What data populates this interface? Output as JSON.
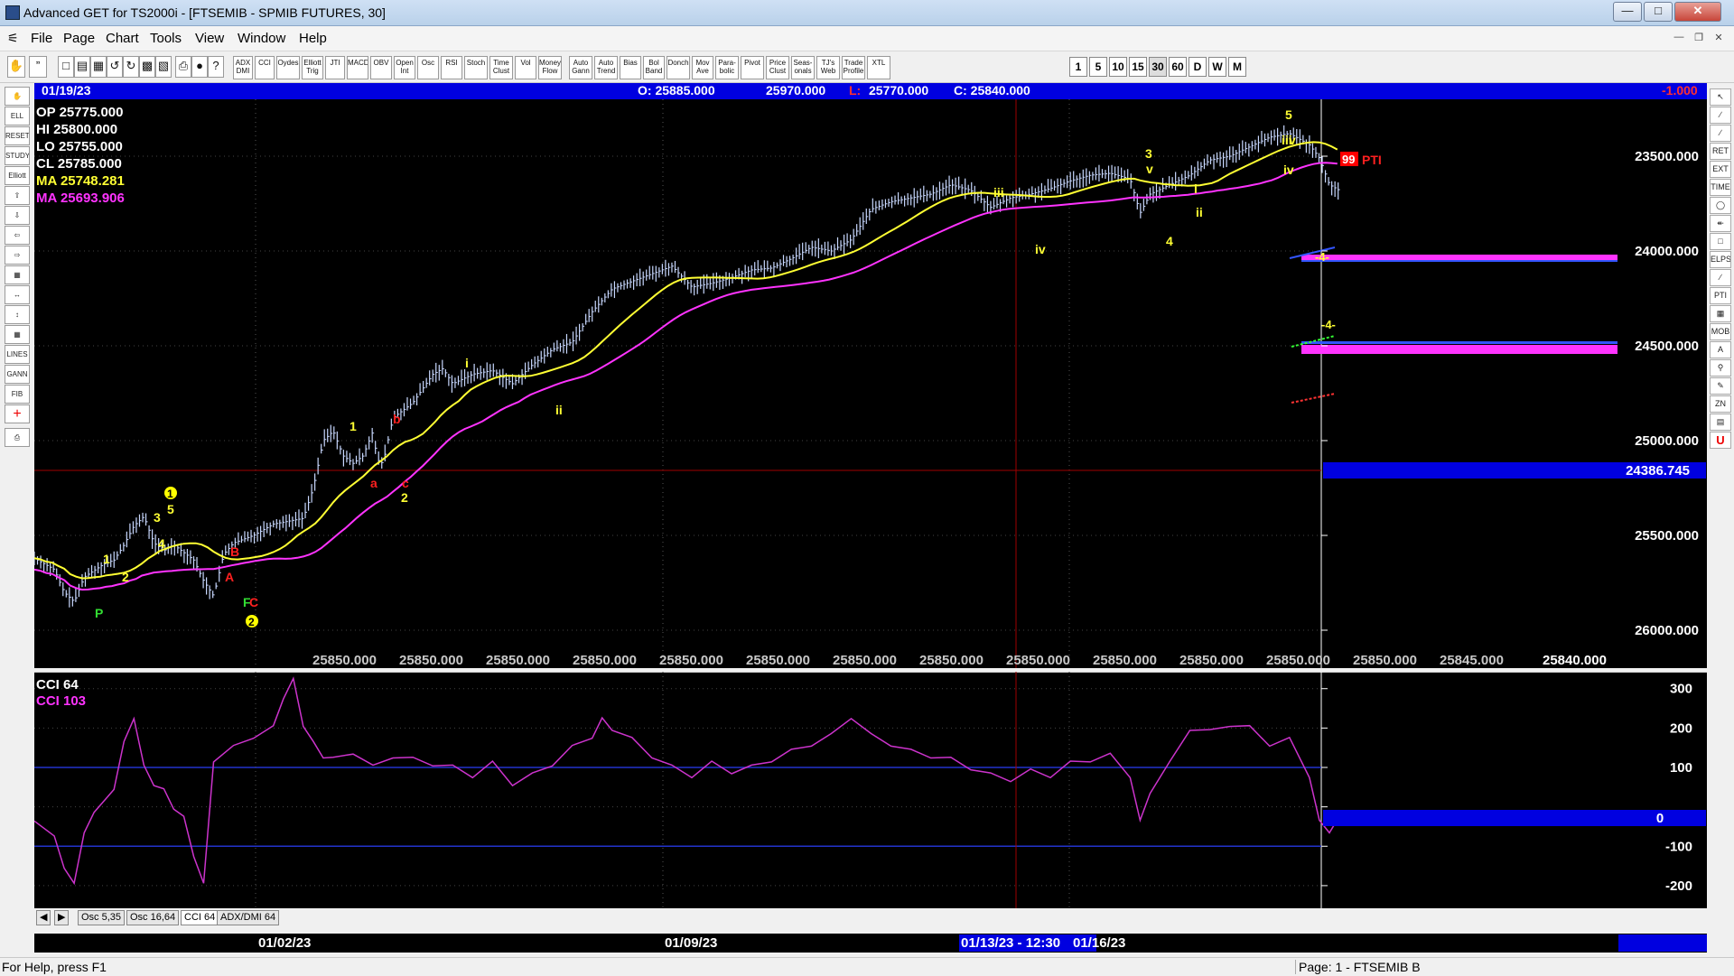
{
  "window": {
    "title": "Advanced GET for TS2000i - [FTSEMIB - SPMIB FUTURES, 30]"
  },
  "menu": {
    "items": [
      "File",
      "Page",
      "Chart",
      "Tools",
      "View",
      "Window",
      "Help"
    ]
  },
  "toolbar": {
    "study_buttons": [
      "ADX DMI",
      "CCI",
      "Oydes",
      "Elliott Trig",
      "JTI",
      "MACD",
      "OBV",
      "Open Int",
      "Osc",
      "RSI",
      "Stoch",
      "Time Clust",
      "Vol",
      "Money Flow",
      "Auto Gann",
      "Auto Trend",
      "Bias",
      "Bol Band",
      "Donch",
      "Mov Ave",
      "Para-bolic",
      "Pivot",
      "Price Clust",
      "Seas-onals",
      "TJ's Web",
      "Trade Profile",
      "XTL"
    ],
    "timeframes": [
      "1",
      "5",
      "10",
      "15",
      "30",
      "60",
      "D",
      "W",
      "M"
    ],
    "active_timeframe": "30"
  },
  "left_tools": [
    "hand",
    "paste",
    "ELLIOTT",
    "RESET",
    "STUDY",
    "Elliott",
    "up",
    "down",
    "left",
    "right",
    "zoom",
    "expand",
    "mid",
    "LINES",
    "GANN",
    "FIB",
    "cross",
    "print"
  ],
  "right_tools": [
    "cursor",
    "line",
    "pitch",
    "FIB RET",
    "FIB EXT",
    "FIB TIME",
    "ring",
    "fan",
    "box",
    "ELPS",
    "channel",
    "PTI",
    "grid",
    "MOB",
    "text",
    "zoom",
    "draw",
    "ZONES",
    "page",
    "U"
  ],
  "info_bar": {
    "date": "01/19/23",
    "open": "O: 25885.000",
    "high": "25970.000",
    "low_label": "L:",
    "low": "25770.000",
    "close": "C: 25840.000",
    "change": "-1.000"
  },
  "ohlc_panel": {
    "op": "OP  25775.000",
    "hi": "HI   25800.000",
    "lo": "LO  25755.000",
    "cl": "CL  25785.000",
    "ma1": "MA  25748.281",
    "ma2": "MA  25693.906"
  },
  "price_axis": {
    "labels": [
      "26000.000",
      "25500.000",
      "25000.000",
      "24500.000",
      "24000.000",
      "23500.000"
    ],
    "cursor_price": "24386.745"
  },
  "bottom_price_labels": [
    "25850.000",
    "25850.000",
    "25850.000",
    "25850.000",
    "25850.000",
    "25850.000",
    "25850.000",
    "25850.000",
    "25850.000",
    "25850.000",
    "25850.000",
    "25850.000",
    "25850.000",
    "25845.000",
    "25840.000"
  ],
  "pti": {
    "value": "99",
    "label": "PTI"
  },
  "projection_labels": [
    "-4-",
    "-4-"
  ],
  "wave_labels": [
    "P",
    "1",
    "2",
    "3",
    "4",
    "5",
    "1",
    "2",
    "B",
    "A",
    "C",
    "F",
    "2",
    "1",
    "a",
    "b",
    "c",
    "2",
    "i",
    "ii",
    "iii",
    "iv",
    "3",
    "v",
    "4",
    "i",
    "ii",
    "5",
    "iii",
    "v",
    "iv"
  ],
  "chart_data": {
    "type": "line",
    "price_axis": {
      "min": 23300,
      "max": 26300,
      "ticks": [
        23500,
        24000,
        24500,
        25000,
        25500,
        26000
      ]
    },
    "series": [
      {
        "name": "MA",
        "role": "fast-ma",
        "color": "#ffff33"
      },
      {
        "name": "MA",
        "role": "slow-ma",
        "color": "#ff33ff"
      }
    ],
    "close_path": [
      [
        0,
        23880
      ],
      [
        10,
        23820
      ],
      [
        15,
        23700
      ],
      [
        20,
        23650
      ],
      [
        25,
        23780
      ],
      [
        35,
        23850
      ],
      [
        40,
        23870
      ],
      [
        45,
        23950
      ],
      [
        50,
        24050
      ],
      [
        55,
        24100
      ],
      [
        60,
        23960
      ],
      [
        65,
        23920
      ],
      [
        70,
        23950
      ],
      [
        80,
        23870
      ],
      [
        85,
        23760
      ],
      [
        90,
        23680
      ],
      [
        95,
        23900
      ],
      [
        100,
        23960
      ],
      [
        110,
        24000
      ],
      [
        120,
        24060
      ],
      [
        135,
        24090
      ],
      [
        140,
        24250
      ],
      [
        145,
        24500
      ],
      [
        150,
        24550
      ],
      [
        155,
        24420
      ],
      [
        160,
        24380
      ],
      [
        165,
        24420
      ],
      [
        170,
        24550
      ],
      [
        172,
        24400
      ],
      [
        175,
        24380
      ],
      [
        180,
        24620
      ],
      [
        190,
        24700
      ],
      [
        200,
        24850
      ],
      [
        205,
        24880
      ],
      [
        210,
        24800
      ],
      [
        220,
        24850
      ],
      [
        230,
        24870
      ],
      [
        240,
        24800
      ],
      [
        250,
        24900
      ],
      [
        260,
        24980
      ],
      [
        270,
        25020
      ],
      [
        280,
        25180
      ],
      [
        290,
        25300
      ],
      [
        300,
        25340
      ],
      [
        310,
        25380
      ],
      [
        320,
        25420
      ],
      [
        330,
        25310
      ],
      [
        340,
        25330
      ],
      [
        350,
        25360
      ],
      [
        360,
        25400
      ],
      [
        370,
        25410
      ],
      [
        380,
        25460
      ],
      [
        390,
        25520
      ],
      [
        400,
        25500
      ],
      [
        410,
        25560
      ],
      [
        420,
        25720
      ],
      [
        430,
        25760
      ],
      [
        440,
        25780
      ],
      [
        450,
        25800
      ],
      [
        460,
        25850
      ],
      [
        470,
        25820
      ],
      [
        480,
        25730
      ],
      [
        490,
        25780
      ],
      [
        500,
        25800
      ],
      [
        510,
        25830
      ],
      [
        520,
        25870
      ],
      [
        530,
        25900
      ],
      [
        540,
        25910
      ],
      [
        550,
        25880
      ],
      [
        555,
        25700
      ],
      [
        560,
        25800
      ],
      [
        570,
        25850
      ],
      [
        580,
        25900
      ],
      [
        590,
        25980
      ],
      [
        600,
        26000
      ],
      [
        610,
        26050
      ],
      [
        620,
        26100
      ],
      [
        630,
        26120
      ],
      [
        640,
        26060
      ],
      [
        645,
        25990
      ],
      [
        650,
        25850
      ],
      [
        655,
        25820
      ]
    ],
    "cci": {
      "name": "CCI 64",
      "value_label": "CCI  103",
      "axis": {
        "min": -230,
        "max": 320,
        "ticks": [
          300,
          200,
          100,
          0,
          -100,
          -200
        ]
      },
      "current": "0",
      "path": [
        [
          0,
          -30
        ],
        [
          10,
          -80
        ],
        [
          15,
          -150
        ],
        [
          20,
          -200
        ],
        [
          25,
          -60
        ],
        [
          30,
          -20
        ],
        [
          40,
          50
        ],
        [
          45,
          160
        ],
        [
          50,
          230
        ],
        [
          55,
          100
        ],
        [
          60,
          60
        ],
        [
          65,
          40
        ],
        [
          70,
          0
        ],
        [
          75,
          -30
        ],
        [
          80,
          -120
        ],
        [
          85,
          -200
        ],
        [
          90,
          120
        ],
        [
          100,
          150
        ],
        [
          110,
          180
        ],
        [
          120,
          200
        ],
        [
          125,
          280
        ],
        [
          130,
          320
        ],
        [
          135,
          210
        ],
        [
          140,
          160
        ],
        [
          145,
          130
        ],
        [
          150,
          120
        ],
        [
          160,
          140
        ],
        [
          170,
          100
        ],
        [
          180,
          130
        ],
        [
          190,
          120
        ],
        [
          200,
          110
        ],
        [
          210,
          100
        ],
        [
          220,
          80
        ],
        [
          230,
          110
        ],
        [
          240,
          60
        ],
        [
          250,
          80
        ],
        [
          260,
          110
        ],
        [
          270,
          150
        ],
        [
          280,
          180
        ],
        [
          285,
          220
        ],
        [
          290,
          200
        ],
        [
          300,
          170
        ],
        [
          310,
          130
        ],
        [
          320,
          100
        ],
        [
          330,
          80
        ],
        [
          340,
          110
        ],
        [
          350,
          90
        ],
        [
          360,
          100
        ],
        [
          370,
          120
        ],
        [
          380,
          140
        ],
        [
          390,
          160
        ],
        [
          400,
          180
        ],
        [
          410,
          230
        ],
        [
          420,
          180
        ],
        [
          430,
          160
        ],
        [
          440,
          140
        ],
        [
          450,
          130
        ],
        [
          460,
          120
        ],
        [
          470,
          100
        ],
        [
          480,
          80
        ],
        [
          490,
          70
        ],
        [
          500,
          90
        ],
        [
          510,
          80
        ],
        [
          520,
          110
        ],
        [
          530,
          120
        ],
        [
          540,
          130
        ],
        [
          550,
          80
        ],
        [
          555,
          -40
        ],
        [
          560,
          40
        ],
        [
          570,
          110
        ],
        [
          580,
          200
        ],
        [
          590,
          190
        ],
        [
          600,
          210
        ],
        [
          610,
          200
        ],
        [
          620,
          160
        ],
        [
          630,
          170
        ],
        [
          640,
          80
        ],
        [
          645,
          -40
        ],
        [
          650,
          -60
        ],
        [
          655,
          -30
        ]
      ]
    }
  },
  "osc_tabs": [
    "Osc 5,35",
    "Osc 16,64",
    "CCI 64",
    "ADX/DMI 64"
  ],
  "date_axis": {
    "labels": [
      "01/02/23",
      "01/09/23",
      "01/16/23"
    ],
    "cursor": "01/13/23 - 12:30"
  },
  "status": {
    "help": "For Help, press F1",
    "page": "Page: 1 - FTSEMIB B"
  }
}
